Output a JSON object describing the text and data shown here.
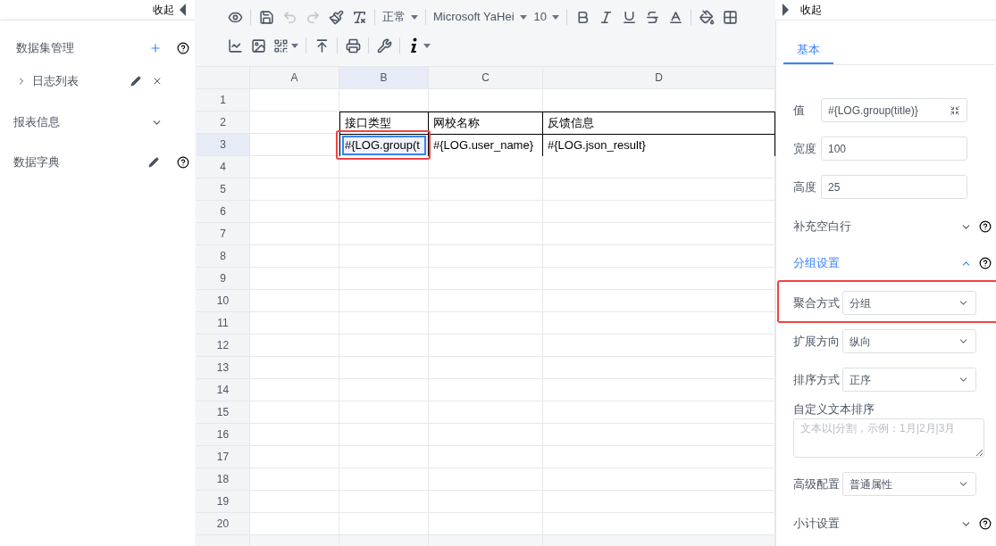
{
  "left_panel": {
    "collapse_label": "收起",
    "items": [
      {
        "kind": "dataset_header",
        "label": "数据集管理"
      },
      {
        "kind": "dataset",
        "label": "日志列表",
        "expanded": false
      },
      {
        "kind": "section",
        "label": "报表信息",
        "expanded": false
      },
      {
        "kind": "dictionary",
        "label": "数据字典"
      }
    ]
  },
  "toolbar": {
    "undo": {
      "disabled": true
    },
    "redo": {
      "disabled": true
    },
    "style": "正常",
    "font": "Microsoft YaHei",
    "size": "10"
  },
  "sheet": {
    "columns": [
      {
        "label": "A",
        "selected": false
      },
      {
        "label": "B",
        "selected": true
      },
      {
        "label": "C",
        "selected": false
      },
      {
        "label": "D",
        "selected": false
      }
    ],
    "rows": [
      {
        "label": "1",
        "selected": false
      },
      {
        "label": "2",
        "selected": false,
        "cells": [
          null,
          {
            "text": "接口类型",
            "selected": false,
            "highlighted": false
          },
          {
            "text": "网校名称",
            "selected": false,
            "highlighted": false
          },
          {
            "text": "反馈信息",
            "selected": false,
            "highlighted": false
          }
        ]
      },
      {
        "label": "3",
        "selected": true,
        "cells": [
          null,
          {
            "text": "#{LOG.group(t",
            "selected": true,
            "highlighted": true
          },
          {
            "text": "#{LOG.user_name}",
            "selected": false,
            "highlighted": false
          },
          {
            "text": "#{LOG.json_result}",
            "selected": false,
            "highlighted": false
          }
        ]
      },
      {
        "label": "4",
        "selected": false
      },
      {
        "label": "5",
        "selected": false
      },
      {
        "label": "6",
        "selected": false
      },
      {
        "label": "7",
        "selected": false
      },
      {
        "label": "8",
        "selected": false
      },
      {
        "label": "9",
        "selected": false
      },
      {
        "label": "10",
        "selected": false
      },
      {
        "label": "11",
        "selected": false
      },
      {
        "label": "12",
        "selected": false
      },
      {
        "label": "13",
        "selected": false
      },
      {
        "label": "14",
        "selected": false
      },
      {
        "label": "15",
        "selected": false
      },
      {
        "label": "16",
        "selected": false
      },
      {
        "label": "17",
        "selected": false
      },
      {
        "label": "18",
        "selected": false
      },
      {
        "label": "19",
        "selected": false
      },
      {
        "label": "20",
        "selected": false
      }
    ]
  },
  "right_panel": {
    "collapse_label": "收起",
    "tabs": [
      {
        "label": "基本",
        "selected": true
      }
    ],
    "fields": [
      {
        "kind": "value_input",
        "label": "值",
        "value": "#{LOG.group(title)}"
      },
      {
        "kind": "input",
        "label": "宽度",
        "value": "100"
      },
      {
        "kind": "input",
        "label": "高度",
        "value": "25"
      },
      {
        "kind": "section",
        "label": "补充空白行",
        "expanded": false
      },
      {
        "kind": "section",
        "label": "分组设置",
        "expanded": true
      },
      {
        "kind": "select",
        "label": "聚合方式",
        "value": "分组",
        "highlighted": true
      },
      {
        "kind": "select",
        "label": "扩展方向",
        "value": "纵向",
        "highlighted": false
      },
      {
        "kind": "select",
        "label": "排序方式",
        "value": "正序",
        "highlighted": false
      },
      {
        "kind": "textarea",
        "label": "自定义文本排序",
        "placeholder": "文本以|分割，示例：1月|2月|3月"
      },
      {
        "kind": "select",
        "label": "高级配置",
        "value": "普通属性",
        "highlighted": false
      },
      {
        "kind": "section",
        "label": "小计设置",
        "expanded": false
      }
    ]
  }
}
